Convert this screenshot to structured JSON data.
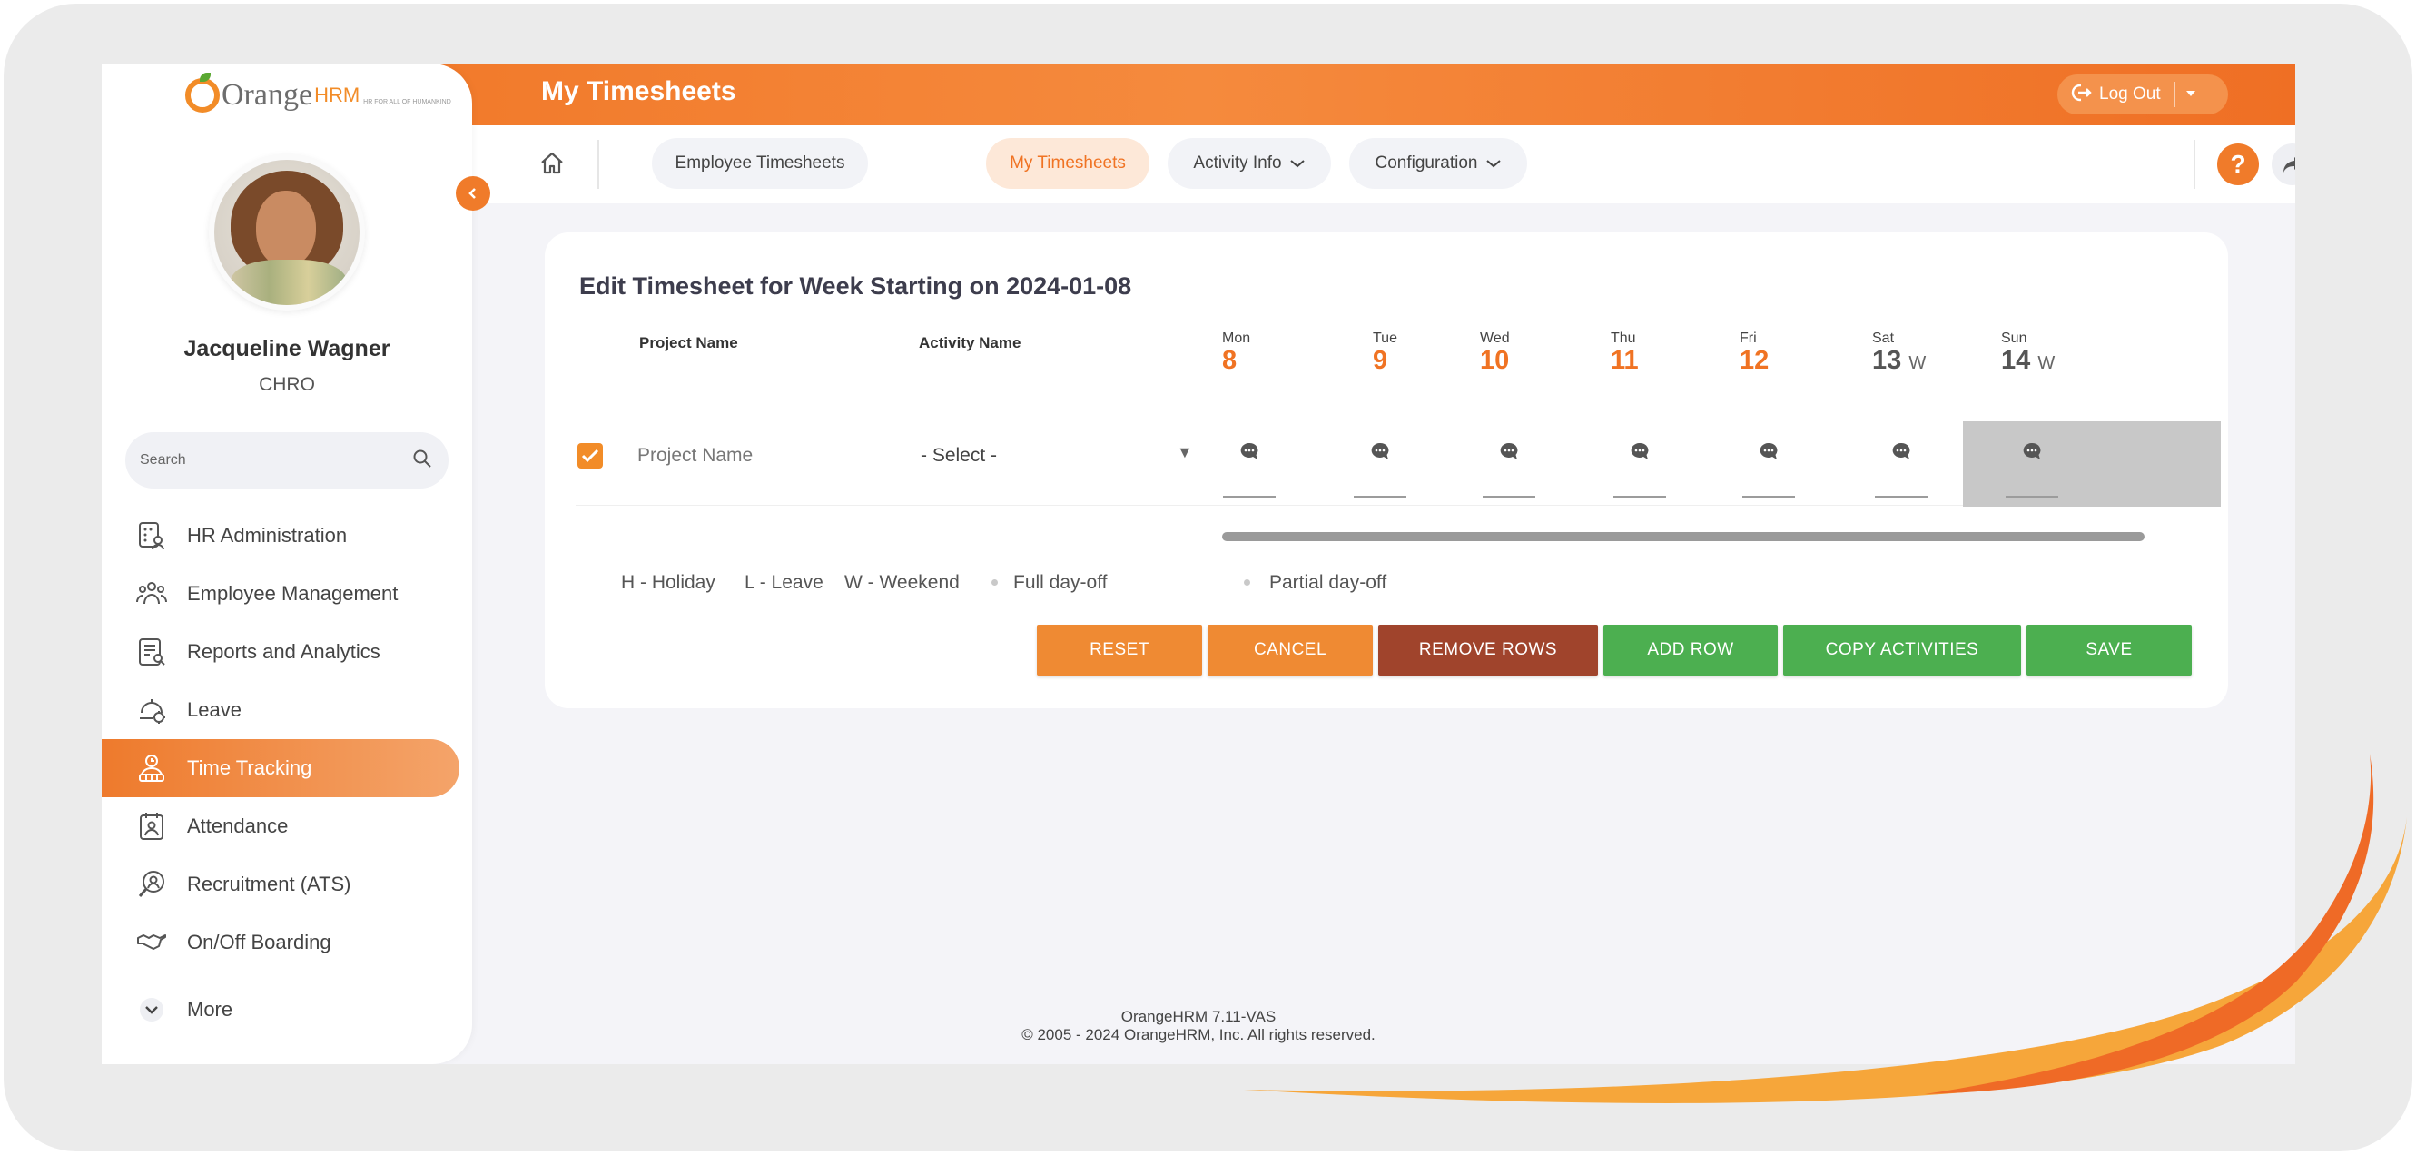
{
  "app": {
    "logo_text": "Orange",
    "logo_hrm": "HRM",
    "logo_tagline": "HR FOR ALL OF HUMANKIND"
  },
  "user": {
    "name": "Jacqueline Wagner",
    "role": "CHRO"
  },
  "search": {
    "placeholder": "Search"
  },
  "sidebar": {
    "items": [
      {
        "label": "HR Administration",
        "icon": "hr-admin-icon"
      },
      {
        "label": "Employee Management",
        "icon": "employee-management-icon"
      },
      {
        "label": "Reports and Analytics",
        "icon": "reports-icon"
      },
      {
        "label": "Leave",
        "icon": "leave-icon"
      },
      {
        "label": "Time Tracking",
        "icon": "time-tracking-icon",
        "active": true
      },
      {
        "label": "Attendance",
        "icon": "attendance-icon"
      },
      {
        "label": "Recruitment (ATS)",
        "icon": "recruitment-icon"
      },
      {
        "label": "On/Off Boarding",
        "icon": "onboarding-icon"
      }
    ],
    "more_label": "More"
  },
  "header": {
    "title": "My Timesheets",
    "logout_label": "Log Out"
  },
  "tabs": [
    {
      "label": "Employee Timesheets"
    },
    {
      "label": "My Timesheets",
      "active": true
    },
    {
      "label": "Activity Info"
    },
    {
      "label": "Configuration"
    }
  ],
  "timesheet": {
    "title": "Edit Timesheet for Week Starting on 2024-01-08",
    "col_project": "Project Name",
    "col_activity": "Activity Name",
    "days": [
      {
        "name": "Mon",
        "date": "8",
        "suffix": ""
      },
      {
        "name": "Tue",
        "date": "9",
        "suffix": ""
      },
      {
        "name": "Wed",
        "date": "10",
        "suffix": ""
      },
      {
        "name": "Thu",
        "date": "11",
        "suffix": ""
      },
      {
        "name": "Fri",
        "date": "12",
        "suffix": ""
      },
      {
        "name": "Sat",
        "date": "13",
        "suffix": "W"
      },
      {
        "name": "Sun",
        "date": "14",
        "suffix": "W"
      }
    ],
    "row": {
      "checked": true,
      "project_placeholder": "Project Name",
      "activity_value": "- Select -"
    },
    "legend": {
      "holiday": "H - Holiday",
      "leave": "L - Leave",
      "weekend": "W - Weekend",
      "full": "Full day-off",
      "partial": "Partial day-off"
    },
    "buttons": {
      "reset": "RESET",
      "cancel": "CANCEL",
      "remove_rows": "REMOVE ROWS",
      "add_row": "ADD ROW",
      "copy_activities": "COPY ACTIVITIES",
      "save": "SAVE"
    }
  },
  "footer": {
    "version": "OrangeHRM 7.11-VAS",
    "copyright_prefix": "© 2005 - 2024 ",
    "company_link": "OrangeHRM, Inc",
    "copyright_suffix": ". All rights reserved."
  },
  "colors": {
    "brand_orange": "#f07323",
    "button_orange": "#ef8a33",
    "button_red": "#a0442c",
    "button_green": "#4caf50"
  }
}
